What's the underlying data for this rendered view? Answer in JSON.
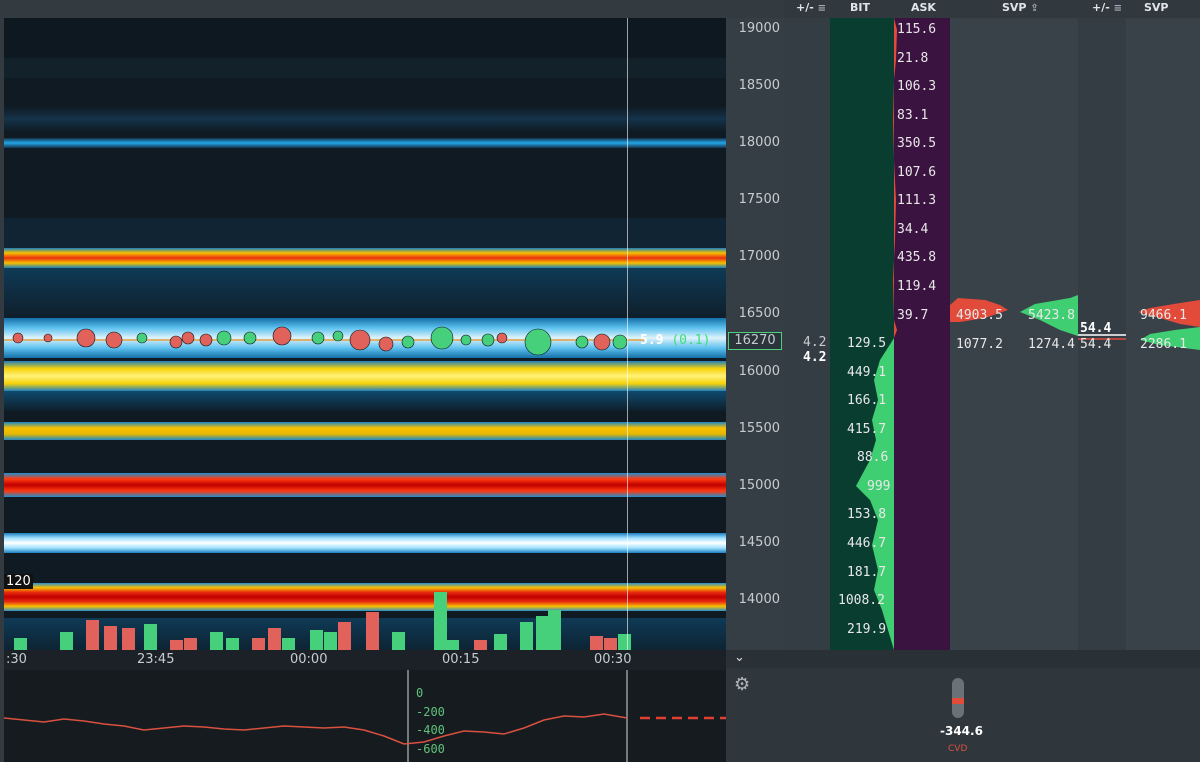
{
  "header": {
    "columns": [
      {
        "label": "+/-",
        "icon": "filter-icon"
      },
      {
        "label": "BIT"
      },
      {
        "label": "ASK"
      },
      {
        "label": "SVP",
        "icon": "cursor-icon"
      },
      {
        "label": "+/-",
        "icon": "filter-icon"
      },
      {
        "label": "SVP"
      }
    ]
  },
  "heatmap": {
    "overlay_label": "120",
    "trade_label": "5.9",
    "trade_label_paren": "(0.1)",
    "colors": {
      "bg": "#0f1a22",
      "blue": "#1e8fd0",
      "yellow": "#f7d20a",
      "red": "#e02810",
      "white": "#f2f6f8"
    }
  },
  "time_axis": {
    "labels": [
      ":30",
      "23:45",
      "00:00",
      "00:15",
      "00:30"
    ]
  },
  "price_axis": {
    "labels": [
      "19000",
      "18500",
      "18000",
      "17500",
      "17000",
      "16500",
      "16000",
      "15500",
      "15000",
      "14500",
      "14000"
    ],
    "current_price": "16270"
  },
  "delta_col": {
    "top": "4.2",
    "bottom": "4.2"
  },
  "bid_values": [
    "129.5",
    "449.1",
    "166.1",
    "415.7",
    "88.6",
    "999",
    "153.8",
    "446.7",
    "181.7",
    "1008.2",
    "219.9"
  ],
  "ask_values": [
    "115.6",
    "21.8",
    "106.3",
    "83.1",
    "350.5",
    "107.6",
    "111.3",
    "34.4",
    "435.8",
    "119.4",
    "39.7"
  ],
  "svp1": {
    "ask_left": "4903.5",
    "ask_right": "5423.8",
    "bid_left": "1077.2",
    "bid_right": "1274.4"
  },
  "delta2": {
    "top": "54.4",
    "bottom": "54.4"
  },
  "svp2": {
    "ask": "9466.1",
    "bid": "2286.1"
  },
  "cvd": {
    "ticks": [
      "0",
      "-200",
      "-400",
      "-600"
    ],
    "value": "-344.6",
    "label": "CVD",
    "line_color": "#d9513f"
  }
}
